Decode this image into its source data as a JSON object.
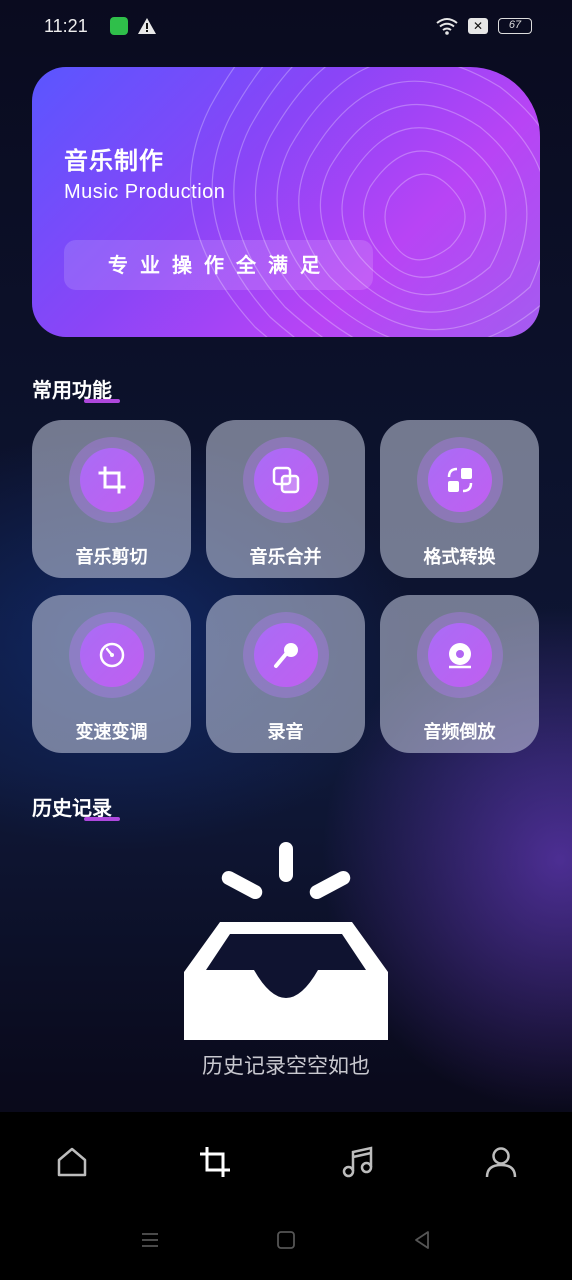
{
  "status_bar": {
    "time": "11:21",
    "battery": "67",
    "icons": [
      "sim-icon",
      "warning-icon",
      "wifi-icon",
      "x-icon",
      "battery-icon"
    ]
  },
  "banner": {
    "title": "音乐制作",
    "subtitle": "Music Production",
    "pill": "专业操作全满足",
    "colors": {
      "start": "#5a56ff",
      "end": "#b844f5"
    }
  },
  "common_section": {
    "title": "常用功能"
  },
  "features": [
    {
      "label": "音乐剪切",
      "icon": "crop-icon"
    },
    {
      "label": "音乐合并",
      "icon": "merge-icon"
    },
    {
      "label": "格式转换",
      "icon": "convert-icon"
    },
    {
      "label": "变速变调",
      "icon": "speed-dial-icon"
    },
    {
      "label": "录音",
      "icon": "microphone-icon"
    },
    {
      "label": "音频倒放",
      "icon": "disc-reverse-icon"
    }
  ],
  "history_section": {
    "title": "历史记录",
    "empty_text": "历史记录空空如也"
  },
  "bottom_nav": [
    {
      "icon": "home-icon"
    },
    {
      "icon": "crop-icon"
    },
    {
      "icon": "music-note-icon"
    },
    {
      "icon": "profile-icon"
    }
  ],
  "system_nav": [
    "menu-icon",
    "home-square-icon",
    "back-icon"
  ],
  "accent_color": "#c05ff0"
}
